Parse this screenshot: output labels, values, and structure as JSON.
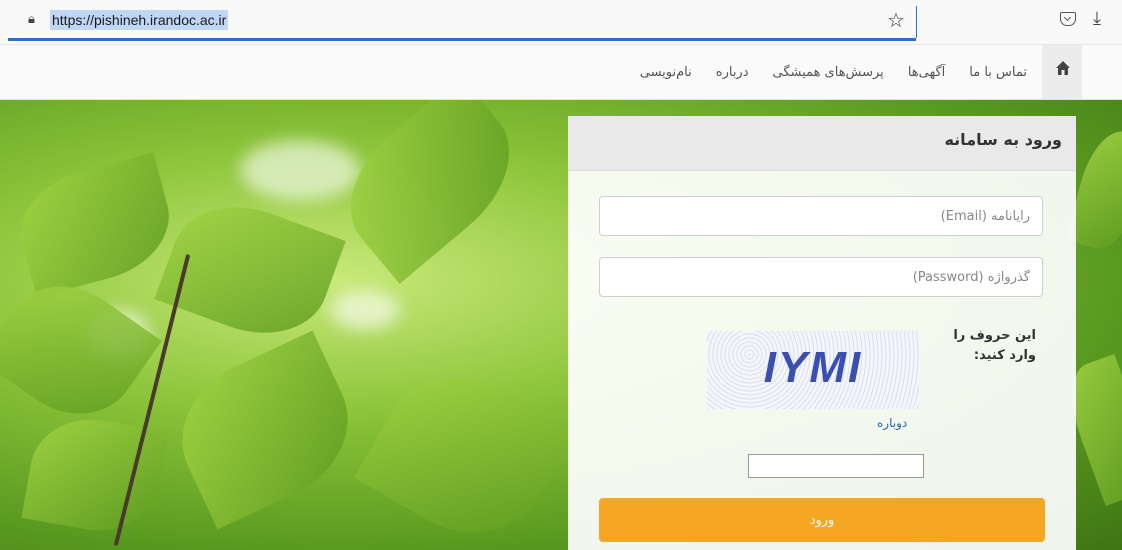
{
  "browser": {
    "url": "https://pishineh.irandoc.ac.ir",
    "icons": [
      "lock-icon",
      "star-icon",
      "pocket-icon",
      "download-icon"
    ]
  },
  "nav": {
    "home_icon": "home-icon",
    "items": [
      "نام‌نویسی",
      "درباره",
      "پرسش‌های همیشگی",
      "آگهی‌ها",
      "تماس با ما"
    ]
  },
  "login": {
    "title": "ورود به سامانه",
    "username_placeholder": "رایانامه (Email)",
    "password_placeholder": "گذرواژه (Password)",
    "captcha_label": "این حروف را وارد کنید:",
    "captcha_text": "IYMI",
    "refresh_label": "دوباره",
    "submit_label": "ورود"
  },
  "colors": {
    "accent": "#f5a623",
    "link": "#2a65b0",
    "url_highlight": "#bfd6f6"
  }
}
